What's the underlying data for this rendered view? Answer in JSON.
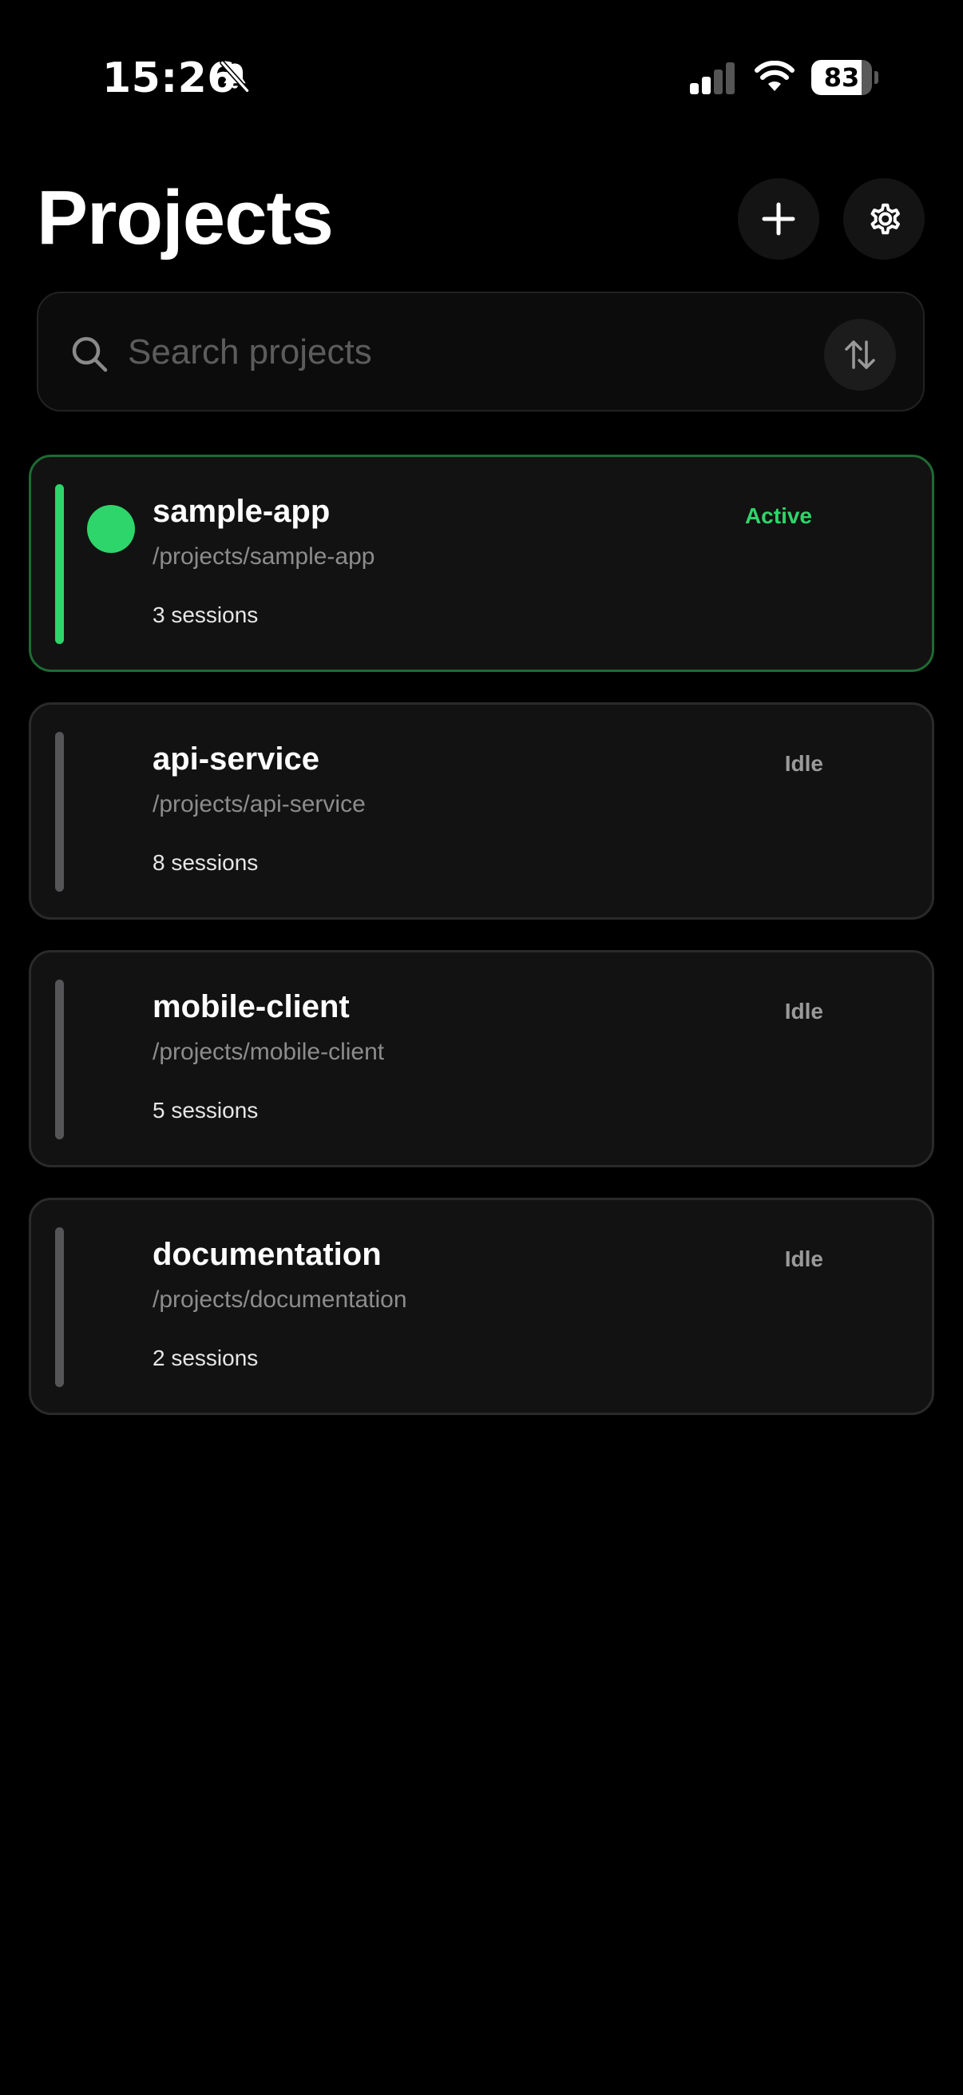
{
  "status_bar": {
    "time": "15:26",
    "battery_level": "83",
    "battery_fraction": 0.83
  },
  "header": {
    "title": "Projects",
    "add_icon": "plus-icon",
    "settings_icon": "gear-icon"
  },
  "search": {
    "placeholder": "Search projects",
    "value": "",
    "sort_icon": "sort-arrows-icon"
  },
  "projects": [
    {
      "name": "sample-app",
      "path": "/projects/sample-app",
      "sessions": "3 sessions",
      "status": "Active"
    },
    {
      "name": "api-service",
      "path": "/projects/api-service",
      "sessions": "8 sessions",
      "status": "Idle"
    },
    {
      "name": "mobile-client",
      "path": "/projects/mobile-client",
      "sessions": "5 sessions",
      "status": "Idle"
    },
    {
      "name": "documentation",
      "path": "/projects/documentation",
      "sessions": "2 sessions",
      "status": "Idle"
    }
  ],
  "colors": {
    "background": "#000000",
    "card": "#121212",
    "active_accent": "#2ed56a",
    "idle_rail": "#555558",
    "muted_text": "#8c8c8c"
  }
}
